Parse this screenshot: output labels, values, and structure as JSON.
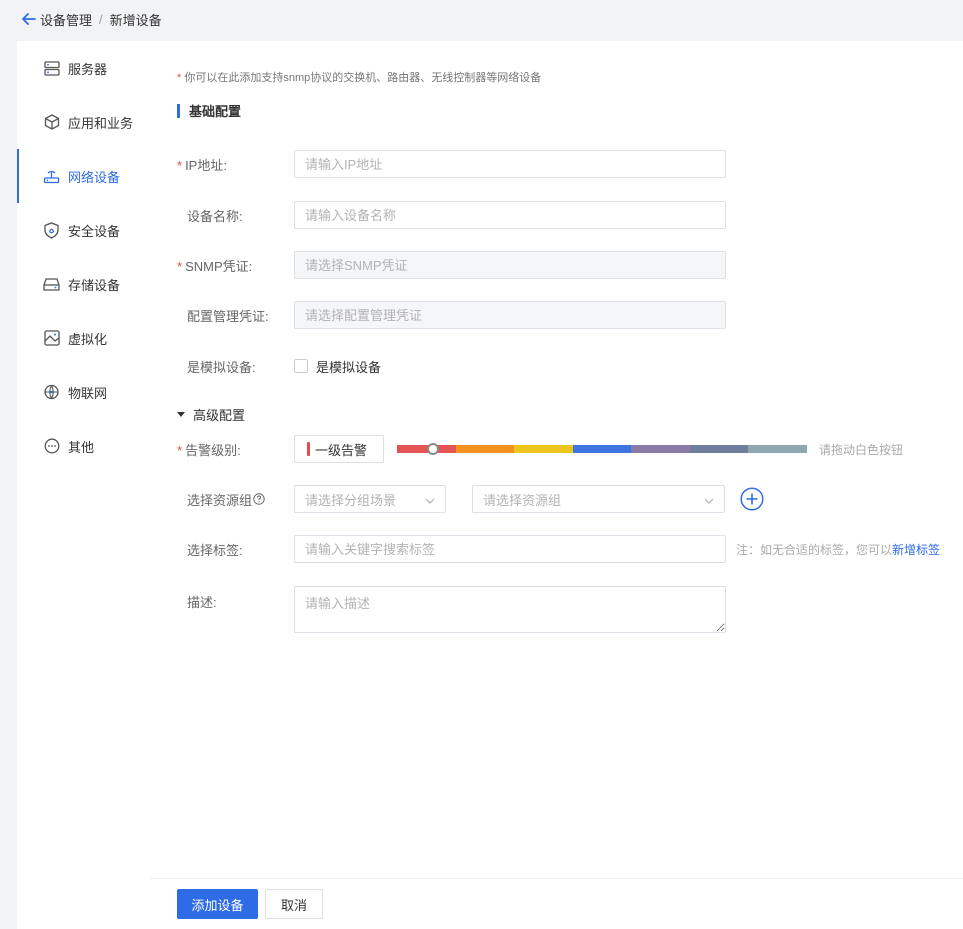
{
  "breadcrumb": {
    "parent": "设备管理",
    "separator": "/",
    "current": "新增设备"
  },
  "sidebar": {
    "items": [
      {
        "label": "服务器",
        "icon": "server-icon"
      },
      {
        "label": "应用和业务",
        "icon": "cube-icon"
      },
      {
        "label": "网络设备",
        "icon": "router-icon",
        "active": true
      },
      {
        "label": "安全设备",
        "icon": "shield-icon"
      },
      {
        "label": "存储设备",
        "icon": "storage-icon"
      },
      {
        "label": "虚拟化",
        "icon": "virtual-icon"
      },
      {
        "label": "物联网",
        "icon": "iot-icon"
      },
      {
        "label": "其他",
        "icon": "more-icon"
      }
    ]
  },
  "form": {
    "note_star": "*",
    "note": "你可以在此添加支持snmp协议的交换机、路由器、无线控制器等网络设备",
    "basic_title": "基础配置",
    "advanced_title": "高级配置",
    "ip": {
      "label": "IP地址:",
      "placeholder": "请输入IP地址"
    },
    "name": {
      "label": "设备名称:",
      "placeholder": "请输入设备名称"
    },
    "snmp": {
      "label": "SNMP凭证:",
      "placeholder": "请选择SNMP凭证"
    },
    "config": {
      "label": "配置管理凭证:",
      "placeholder": "请选择配置管理凭证"
    },
    "simulated": {
      "label": "是模拟设备:",
      "checkbox_label": "是模拟设备",
      "checked": false
    },
    "alarm": {
      "label": "告警级别:",
      "value": "一级告警",
      "hint": "请拖动白色按钮",
      "level": 1,
      "colors": [
        "#e45454",
        "#f2921e",
        "#eec41f",
        "#3f74e3",
        "#8a7aa6",
        "#6f7e9c",
        "#8fa6b3"
      ]
    },
    "resource": {
      "label": "选择资源组",
      "scene_placeholder": "请选择分组场景",
      "group_placeholder": "请选择资源组"
    },
    "tags": {
      "label": "选择标签:",
      "placeholder": "请输入关键字搜索标签",
      "note": "注：如无合适的标签，您可以",
      "link": "新增标签"
    },
    "desc": {
      "label": "描述:",
      "placeholder": "请输入描述"
    }
  },
  "footer": {
    "submit": "添加设备",
    "cancel": "取消"
  },
  "colors": {
    "primary": "#2e6be6",
    "required": "#e34d4d"
  }
}
